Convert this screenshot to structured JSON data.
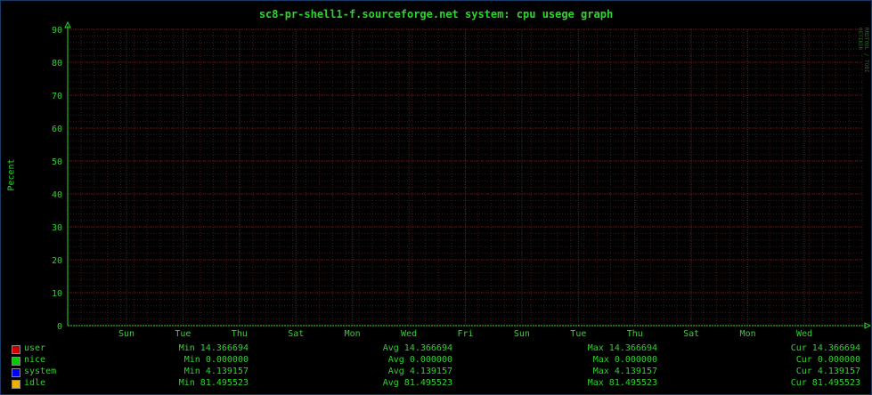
{
  "chart_data": {
    "type": "line",
    "title": "sc8-pr-shell1-f.sourceforge.net system: cpu usege graph",
    "ylabel": "Pecent",
    "ylim": [
      0,
      90
    ],
    "yticks": [
      "0",
      "10",
      "20",
      "30",
      "40",
      "50",
      "60",
      "70",
      "80",
      "90"
    ],
    "xticks": [
      "Sun",
      "Tue",
      "Thu",
      "Sat",
      "Mon",
      "Wed",
      "Fri",
      "Sun",
      "Tue",
      "Thu",
      "Sat",
      "Mon",
      "Wed"
    ],
    "grid": true,
    "series": [
      {
        "name": "user",
        "color": "#cc0000",
        "min": "Min 14.366694",
        "avg": "Avg 14.366694",
        "max": "Max 14.366694",
        "cur": "Cur 14.366694"
      },
      {
        "name": "nice",
        "color": "#00cc00",
        "min": "Min 0.000000",
        "avg": "Avg 0.000000",
        "max": "Max 0.000000",
        "cur": "Cur 0.000000"
      },
      {
        "name": "system",
        "color": "#0000ff",
        "min": "Min 4.139157",
        "avg": "Avg 4.139157",
        "max": "Max 4.139157",
        "cur": "Cur 4.139157"
      },
      {
        "name": "idle",
        "color": "#f0b000",
        "min": "Min 81.495523",
        "avg": "Avg 81.495523",
        "max": "Max 81.495523",
        "cur": "Cur 81.495523"
      }
    ]
  },
  "watermark": "RRDTOOL / TOBI OETIKER"
}
